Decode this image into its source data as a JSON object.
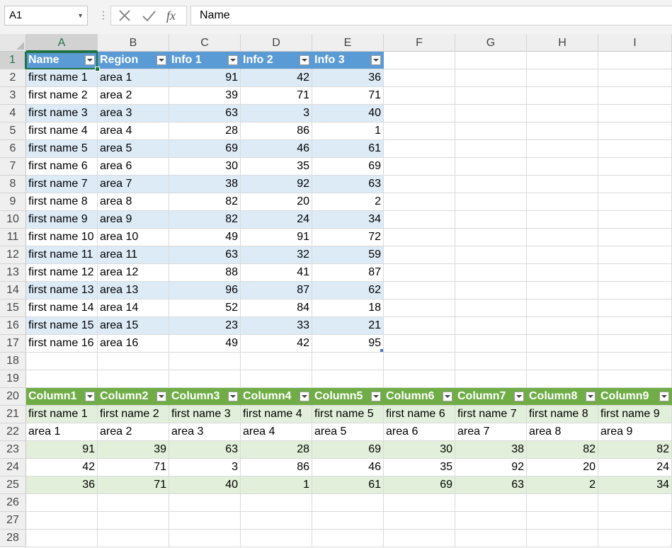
{
  "name_box": "A1",
  "formula_bar": {
    "value": "Name"
  },
  "columns": [
    "A",
    "B",
    "C",
    "D",
    "E",
    "F",
    "G",
    "H",
    "I"
  ],
  "rows": [
    "1",
    "2",
    "3",
    "4",
    "5",
    "6",
    "7",
    "8",
    "9",
    "10",
    "11",
    "12",
    "13",
    "14",
    "15",
    "16",
    "17",
    "18",
    "19",
    "20",
    "21",
    "22",
    "23",
    "24",
    "25",
    "26",
    "27",
    "28"
  ],
  "table1": {
    "headers": [
      "Name",
      "Region",
      "Info 1",
      "Info 2",
      "Info 3"
    ],
    "rows": [
      [
        "first name 1",
        "area 1",
        "91",
        "42",
        "36"
      ],
      [
        "first name 2",
        "area 2",
        "39",
        "71",
        "71"
      ],
      [
        "first name 3",
        "area 3",
        "63",
        "3",
        "40"
      ],
      [
        "first name 4",
        "area 4",
        "28",
        "86",
        "1"
      ],
      [
        "first name 5",
        "area 5",
        "69",
        "46",
        "61"
      ],
      [
        "first name 6",
        "area 6",
        "30",
        "35",
        "69"
      ],
      [
        "first name 7",
        "area 7",
        "38",
        "92",
        "63"
      ],
      [
        "first name 8",
        "area 8",
        "82",
        "20",
        "2"
      ],
      [
        "first name 9",
        "area 9",
        "82",
        "24",
        "34"
      ],
      [
        "first name 10",
        "area 10",
        "49",
        "91",
        "72"
      ],
      [
        "first name 11",
        "area 11",
        "63",
        "32",
        "59"
      ],
      [
        "first name 12",
        "area 12",
        "88",
        "41",
        "87"
      ],
      [
        "first name 13",
        "area 13",
        "96",
        "87",
        "62"
      ],
      [
        "first name 14",
        "area 14",
        "52",
        "84",
        "18"
      ],
      [
        "first name 15",
        "area 15",
        "23",
        "33",
        "21"
      ],
      [
        "first name 16",
        "area 16",
        "49",
        "42",
        "95"
      ]
    ]
  },
  "table2": {
    "headers": [
      "Column1",
      "Column2",
      "Column3",
      "Column4",
      "Column5",
      "Column6",
      "Column7",
      "Column8",
      "Column9"
    ],
    "rows": [
      [
        "first name 1",
        "first name 2",
        "first name 3",
        "first name 4",
        "first name 5",
        "first name 6",
        "first name 7",
        "first name 8",
        "first name 9"
      ],
      [
        "area 1",
        "area 2",
        "area 3",
        "area 4",
        "area 5",
        "area 6",
        "area 7",
        "area 8",
        "area 9"
      ],
      [
        "91",
        "39",
        "63",
        "28",
        "69",
        "30",
        "38",
        "82",
        "82"
      ],
      [
        "42",
        "71",
        "3",
        "86",
        "46",
        "35",
        "92",
        "20",
        "24"
      ],
      [
        "36",
        "71",
        "40",
        "1",
        "61",
        "69",
        "63",
        "2",
        "34"
      ]
    ]
  },
  "colors": {
    "accent": "#217346",
    "table1_header": "#5b9bd5",
    "table1_band": "#ddebf7",
    "table2_header": "#70ad47",
    "table2_band": "#e2efda"
  },
  "icons": {
    "cancel": "cancel-icon",
    "enter": "check-icon",
    "function": "fx-icon"
  }
}
